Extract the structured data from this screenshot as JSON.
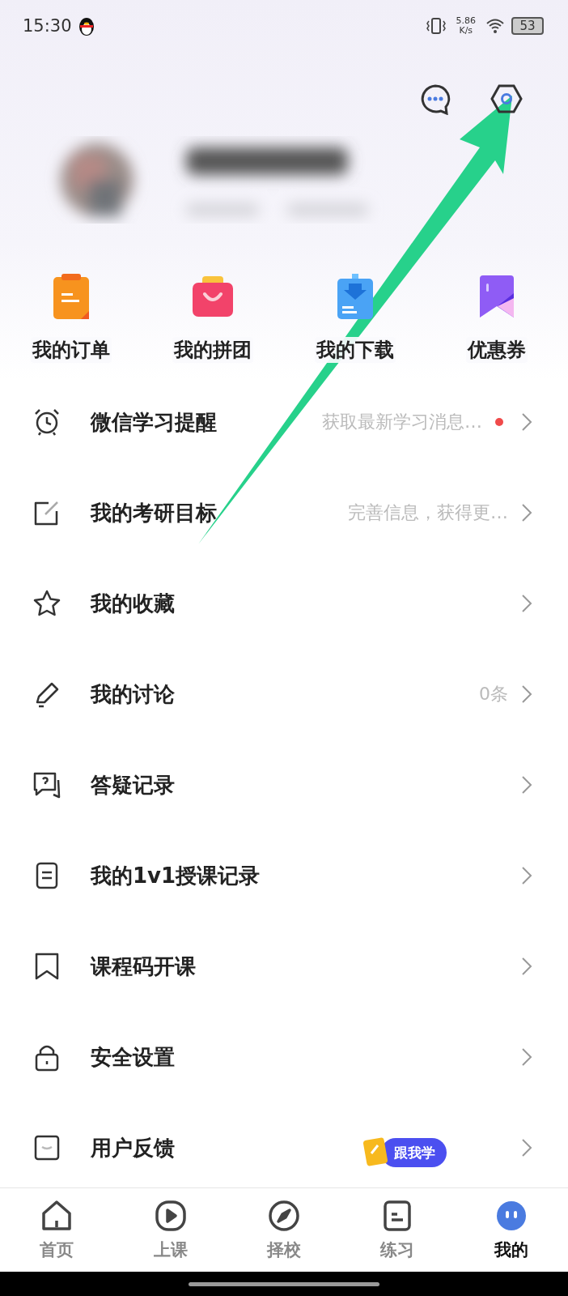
{
  "status_bar": {
    "time": "15:30",
    "speed": "5.86",
    "speed_unit": "K/s",
    "battery": "53"
  },
  "quick_menu": [
    {
      "label": "我的订单"
    },
    {
      "label": "我的拼团"
    },
    {
      "label": "我的下载"
    },
    {
      "label": "优惠券"
    }
  ],
  "menu": [
    {
      "label": "微信学习提醒",
      "detail": "获取最新学习消息…",
      "dot": true
    },
    {
      "label": "我的考研目标",
      "detail": "完善信息，获得更…",
      "dot": false
    },
    {
      "label": "我的收藏",
      "dot": false
    },
    {
      "label": "我的讨论",
      "detail": "0条",
      "dot": false
    },
    {
      "label": "答疑记录",
      "dot": false
    },
    {
      "label": "我的1v1授课记录",
      "dot": false
    },
    {
      "label": "课程码开课",
      "dot": false
    },
    {
      "label": "安全设置",
      "dot": false
    },
    {
      "label": "用户反馈",
      "dot": false
    }
  ],
  "floating_badge": "跟我学",
  "tabs": [
    {
      "label": "首页",
      "selected": false
    },
    {
      "label": "上课",
      "selected": false
    },
    {
      "label": "择校",
      "selected": false
    },
    {
      "label": "练习",
      "selected": false
    },
    {
      "label": "我的",
      "selected": true
    }
  ]
}
